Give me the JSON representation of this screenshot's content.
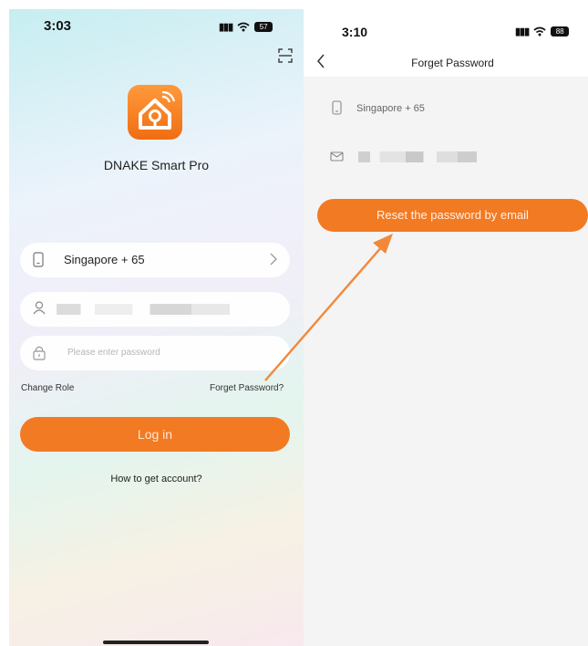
{
  "caption": "",
  "left": {
    "status_time": "3:03",
    "battery": "57",
    "app_name": "DNAKE Smart Pro",
    "country_field": "Singapore + 65",
    "username_value": "",
    "password_placeholder": "Please enter password",
    "change_role": "Change Role",
    "forget_password": "Forget Password?",
    "login_label": "Log in",
    "get_account": "How to get account?"
  },
  "right": {
    "status_time": "3:10",
    "battery": "88",
    "title": "Forget Password",
    "country_field": "Singapore + 65",
    "email_value": "",
    "reset_label": "Reset the password by email"
  },
  "colors": {
    "accent": "#f27a23",
    "arrow": "#f2883a"
  },
  "icons": [
    "scan-icon",
    "app-logo-icon",
    "phone-icon",
    "chevron-right-icon",
    "user-icon",
    "lock-icon",
    "back-icon",
    "mail-icon",
    "signal-icon",
    "wifi-icon",
    "battery-icon"
  ]
}
